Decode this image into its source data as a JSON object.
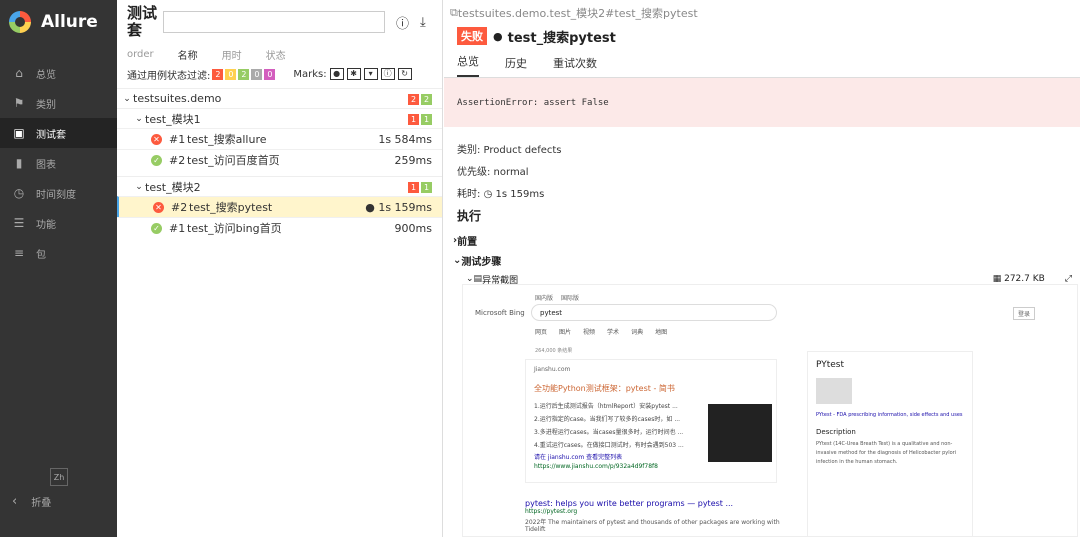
{
  "app": {
    "name": "Allure"
  },
  "sidebar": {
    "items": [
      {
        "label": "总览",
        "icon": "home-icon"
      },
      {
        "label": "类别",
        "icon": "flag-icon"
      },
      {
        "label": "测试套",
        "icon": "briefcase-icon"
      },
      {
        "label": "图表",
        "icon": "bar-chart-icon"
      },
      {
        "label": "时间刻度",
        "icon": "clock-icon"
      },
      {
        "label": "功能",
        "icon": "list-icon"
      },
      {
        "label": "包",
        "icon": "align-left-icon"
      }
    ],
    "lang": "Zh",
    "collapse": "折叠"
  },
  "suites": {
    "title": "测试套",
    "sort": [
      "order",
      "名称",
      "用时",
      "状态"
    ],
    "filter_label": "通过用例状态过滤:",
    "filter_counts": [
      "2",
      "0",
      "2",
      "0",
      "0"
    ],
    "marks_label": "Marks:",
    "root": {
      "name": "testsuites.demo",
      "failed": "2",
      "passed": "2"
    },
    "groups": [
      {
        "name": "test_模块1",
        "failed": "1",
        "passed": "1",
        "cases": [
          {
            "num": "#1",
            "name": "test_搜索allure",
            "time": "1s 584ms",
            "status": "failed"
          },
          {
            "num": "#2",
            "name": "test_访问百度首页",
            "time": "259ms",
            "status": "passed"
          }
        ]
      },
      {
        "name": "test_模块2",
        "failed": "1",
        "passed": "1",
        "cases": [
          {
            "num": "#2",
            "name": "test_搜索pytest",
            "time": "1s 159ms",
            "status": "failed"
          },
          {
            "num": "#1",
            "name": "test_访问bing首页",
            "time": "900ms",
            "status": "passed"
          }
        ]
      }
    ]
  },
  "detail": {
    "breadcrumb": "testsuites.demo.test_模块2#test_搜索pytest",
    "status": "失败",
    "title": "test_搜索pytest",
    "tabs": [
      "总览",
      "历史",
      "重试次数"
    ],
    "error": "AssertionError: assert False",
    "category": "类别: Product defects",
    "severity": "优先级: normal",
    "duration_label": "耗时:",
    "duration": "1s 159ms",
    "exec": "执行",
    "setup": "前置",
    "steps": "测试步骤",
    "attachment": "异常截图",
    "attachment_size": "272.7 KB"
  },
  "screenshot": {
    "tabs": [
      "国内版",
      "国际版"
    ],
    "logo": "Microsoft Bing",
    "query": "pytest",
    "login": "登录",
    "nav": [
      "网页",
      "图片",
      "视频",
      "学术",
      "词典",
      "地图"
    ],
    "count": "264,000 条结果",
    "r1_src": "Jianshu.com",
    "r1_title": "全功能Python测试框架：pytest - 简书",
    "r1_lines": [
      "1.运行后生成测试报告（htmlReport）安装pytest ...",
      "2.运行指定的case。当我们写了较多的cases时，如 ...",
      "3.多进程运行cases。当cases量很多时，运行时间也 ...",
      "4.重试运行cases。在做接口测试时，有时会遇到503 ..."
    ],
    "r1_more": "请在 jianshu.com 查看完整列表",
    "r1_url": "https://www.jianshu.com/p/932a4d9f78f8",
    "r2_title": "pytest: helps you write better programs — pytest ...",
    "r2_url": "https://pytest.org",
    "r2_text": "2022年 The maintainers of pytest and thousands of other packages are working with Tidelift",
    "kg_title": "PYtest",
    "kg_link": "PYtest - FDA prescribing information, side effects and uses",
    "kg_desc": "Description",
    "kg_text": "PYtest (14C-Urea Breath Test) is a qualitative and non-invasive method for the diagnosis of Helicobacter pylori infection in the human stomach."
  }
}
